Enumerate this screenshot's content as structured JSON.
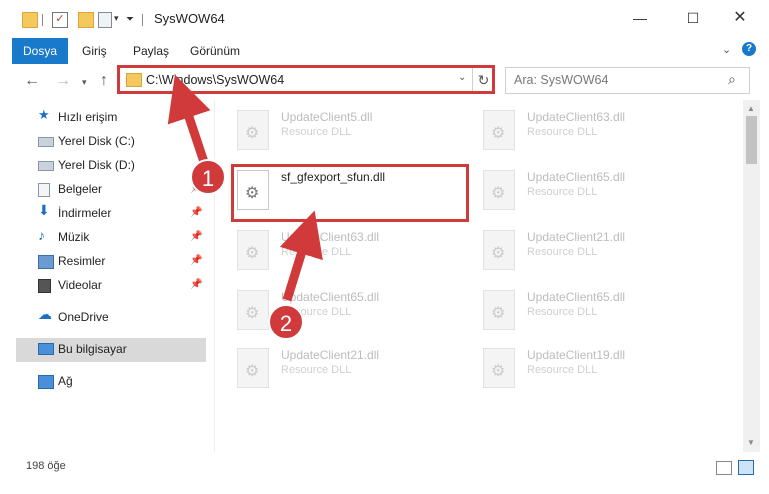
{
  "window": {
    "title": "SysWOW64",
    "accent": "#1979ca"
  },
  "ribbon": {
    "tabs": [
      "Dosya",
      "Giriş",
      "Paylaş",
      "Görünüm"
    ]
  },
  "address": {
    "path": "C:\\Windows\\SysWOW64",
    "search_placeholder": "Ara: SysWOW64"
  },
  "sidebar": {
    "items": [
      {
        "label": "Hızlı erişim",
        "icon": "star-icon",
        "pinned": false
      },
      {
        "label": "Yerel Disk (C:)",
        "icon": "drive-icon",
        "pinned": false
      },
      {
        "label": "Yerel Disk (D:)",
        "icon": "drive-icon",
        "pinned": false
      },
      {
        "label": "Belgeler",
        "icon": "documents-icon",
        "pinned": true
      },
      {
        "label": "İndirmeler",
        "icon": "download-icon",
        "pinned": true
      },
      {
        "label": "Müzik",
        "icon": "music-icon",
        "pinned": true
      },
      {
        "label": "Resimler",
        "icon": "pictures-icon",
        "pinned": true
      },
      {
        "label": "Videolar",
        "icon": "videos-icon",
        "pinned": true
      },
      {
        "label": "OneDrive",
        "icon": "cloud-icon",
        "pinned": false
      },
      {
        "label": "Bu bilgisayar",
        "icon": "computer-icon",
        "pinned": false,
        "selected": true
      },
      {
        "label": "Ağ",
        "icon": "network-icon",
        "pinned": false
      }
    ]
  },
  "files": [
    {
      "name": "UpdateClient5.dll",
      "type": "Resource DLL"
    },
    {
      "name": "UpdateClient63.dll",
      "type": "Resource DLL"
    },
    {
      "name": "sf_gfexport_sfun.dll",
      "type": "",
      "highlighted": true
    },
    {
      "name": "UpdateClient65.dll",
      "type": "Resource DLL"
    },
    {
      "name": "UpdateClient63.dll",
      "type": "Resource DLL"
    },
    {
      "name": "UpdateClient21.dll",
      "type": "Resource DLL"
    },
    {
      "name": "UpdateClient65.dll",
      "type": "Resource DLL"
    },
    {
      "name": "UpdateClient65.dll",
      "type": "Resource DLL"
    },
    {
      "name": "UpdateClient21.dll",
      "type": "Resource DLL"
    },
    {
      "name": "UpdateClient19.dll",
      "type": "Resource DLL"
    }
  ],
  "status": {
    "item_count": "198 öğe"
  },
  "annotations": {
    "badge1": "1",
    "badge2": "2",
    "color": "#d03a3a"
  }
}
